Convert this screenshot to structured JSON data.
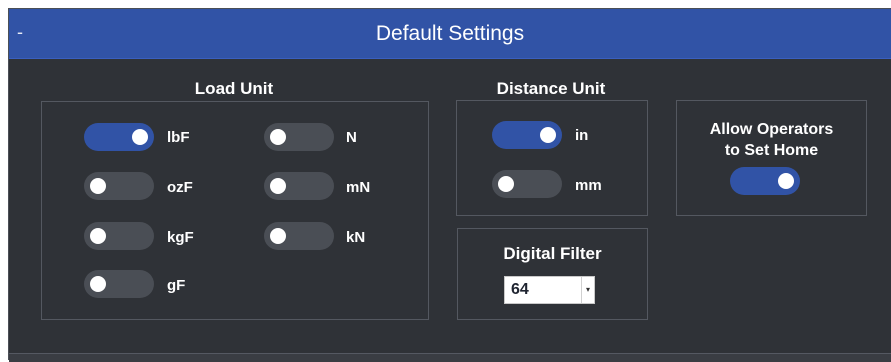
{
  "header": {
    "collapse": "-",
    "title": "Default Settings"
  },
  "load_unit": {
    "title": "Load Unit",
    "options": [
      {
        "label": "lbF",
        "on": true
      },
      {
        "label": "ozF",
        "on": false
      },
      {
        "label": "kgF",
        "on": false
      },
      {
        "label": "gF",
        "on": false
      },
      {
        "label": "N",
        "on": false
      },
      {
        "label": "mN",
        "on": false
      },
      {
        "label": "kN",
        "on": false
      }
    ]
  },
  "distance_unit": {
    "title": "Distance Unit",
    "options": [
      {
        "label": "in",
        "on": true
      },
      {
        "label": "mm",
        "on": false
      }
    ]
  },
  "allow_home": {
    "line1": "Allow Operators",
    "line2": "to Set Home",
    "on": true
  },
  "digital_filter": {
    "title": "Digital Filter",
    "value": "64"
  },
  "colors": {
    "panel_bg": "#2f3237",
    "header_bg": "#3153a6",
    "toggle_on": "#3153a6",
    "toggle_off": "#4a4e55"
  }
}
